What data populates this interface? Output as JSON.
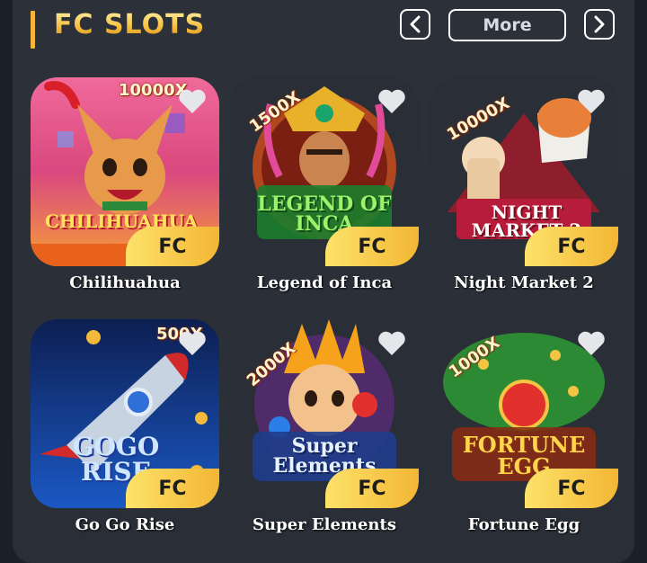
{
  "header": {
    "title": "FC SLOTS",
    "more_label": "More",
    "prev_icon": "chevron-left-icon",
    "next_icon": "chevron-right-icon"
  },
  "colors": {
    "accent": "#f3b53a",
    "badge": "#f8cf4c",
    "panel": "#2c3139"
  },
  "games": [
    {
      "name": "Chilihuahua",
      "badge": "FC",
      "multiplier": "10000X",
      "logo": "CHILIHUAHUA"
    },
    {
      "name": "Legend of Inca",
      "badge": "FC",
      "multiplier": "1500X",
      "logo": "LEGEND OF INCA"
    },
    {
      "name": "Night Market 2",
      "badge": "FC",
      "multiplier": "10000X",
      "logo": "NIGHT MARKET 2"
    },
    {
      "name": "Go Go Rise",
      "badge": "FC",
      "multiplier": "500X",
      "logo": "GOGO RISE"
    },
    {
      "name": "Super Elements",
      "badge": "FC",
      "multiplier": "2000X",
      "logo": "Super Elements"
    },
    {
      "name": "Fortune Egg",
      "badge": "FC",
      "multiplier": "1000X",
      "logo": "FORTUNE EGG"
    }
  ]
}
